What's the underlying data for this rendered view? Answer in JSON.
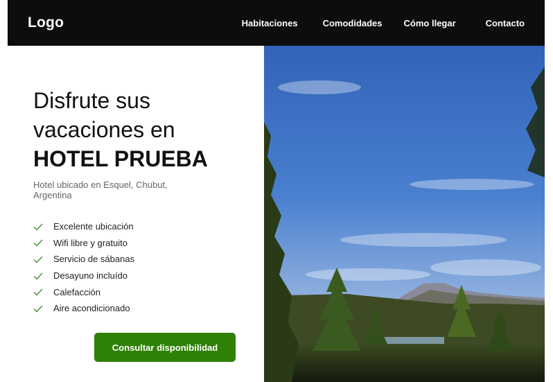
{
  "nav": {
    "logo": "Logo",
    "links": [
      "Habitaciones",
      "Comodidades",
      "Cómo llegar",
      "Contacto"
    ]
  },
  "hero": {
    "title_line1": "Disfrute sus",
    "title_line2": "vacaciones en",
    "title_brand": "HOTEL PRUEBA",
    "subtitle": "Hotel ubicado en Esquel, Chubut, Argentina",
    "features": [
      "Excelente ubicación",
      "Wifi libre y gratuito",
      "Servicio de sábanas",
      "Desayuno incluído",
      "Calefacción",
      "Aire acondicionado"
    ],
    "cta_label": "Consultar disponibilidad",
    "image_icon": "landscape-photo"
  },
  "colors": {
    "nav_bg": "#0d0d0d",
    "accent": "#2e8006",
    "check": "#3a8a2a",
    "sky": "#3a6fc4"
  }
}
